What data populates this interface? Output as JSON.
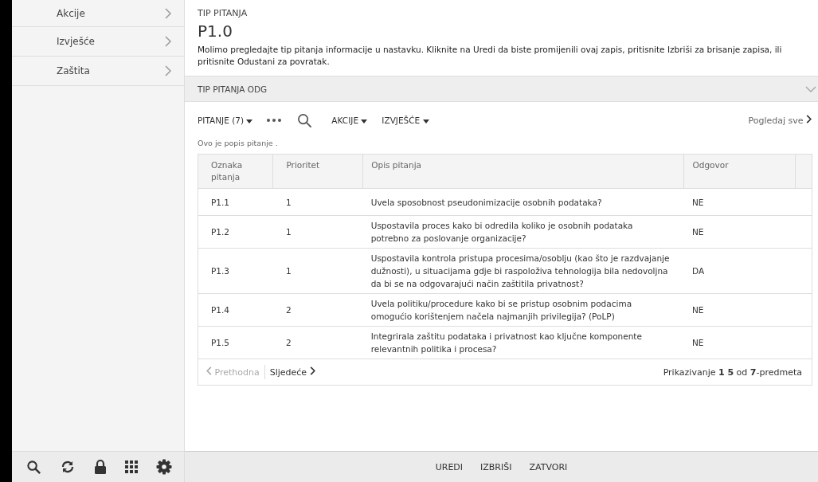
{
  "sidebar": {
    "items": [
      {
        "label": "Akcije"
      },
      {
        "label": "Izvješće"
      },
      {
        "label": "Zaštita"
      }
    ]
  },
  "header": {
    "type_label": "TIP PITANJA",
    "title": "P1.0",
    "description": "Molimo pregledajte tip pitanja informacije u nastavku. Kliknite na Uredi da biste promijenili ovaj zapis, pritisnite Izbriši za brisanje zapisa, ili pritisnite Odustani za povratak."
  },
  "section": {
    "title": "TIP PITANJA ODG",
    "expanded": true
  },
  "toolbar": {
    "list_menu": "PITANJE (7)",
    "actions_menu": "AKCIJE",
    "reports_menu": "IZVJEŠĆE",
    "view_all": "Pogledaj sve"
  },
  "list_description": "Ovo je popis pitanje .",
  "table": {
    "columns": [
      "Oznaka pitanja",
      "Prioritet",
      "Opis pitanja",
      "Odgovor"
    ],
    "rows": [
      [
        "P1.1",
        "1",
        "Uvela sposobnost pseudonimizacije osobnih podataka?",
        "NE"
      ],
      [
        "P1.2",
        "1",
        "Uspostavila proces kako bi odredila koliko je osobnih podataka potrebno za poslovanje organizacije?",
        "NE"
      ],
      [
        "P1.3",
        "1",
        "Uspostavila kontrola pristupa procesima/osoblju (kao što je razdvajanje dužnosti), u situacijama gdje bi raspoloživa tehnologija bila nedovoljna da bi se na odgovarajući način zaštitila privatnost?",
        "DA"
      ],
      [
        "P1.4",
        "2",
        "Uvela politiku/procedure kako bi se pristup osobnim podacima omogućio korištenjem načela najmanjih privilegija? (PoLP)",
        "NE"
      ],
      [
        "P1.5",
        "2",
        "Integrirala zaštitu podataka i privatnost kao ključne komponente relevantnih politika i procesa?",
        "NE"
      ]
    ]
  },
  "pagination": {
    "previous": {
      "label": "Prethodna",
      "disabled": true
    },
    "next": {
      "label": "Sljedeće",
      "disabled": false
    },
    "summary": "Prikazivanje **1 5** od **7**-predmeta"
  },
  "footer_buttons": [
    "UREDI",
    "IZBRIŠI",
    "ZATVORI"
  ]
}
